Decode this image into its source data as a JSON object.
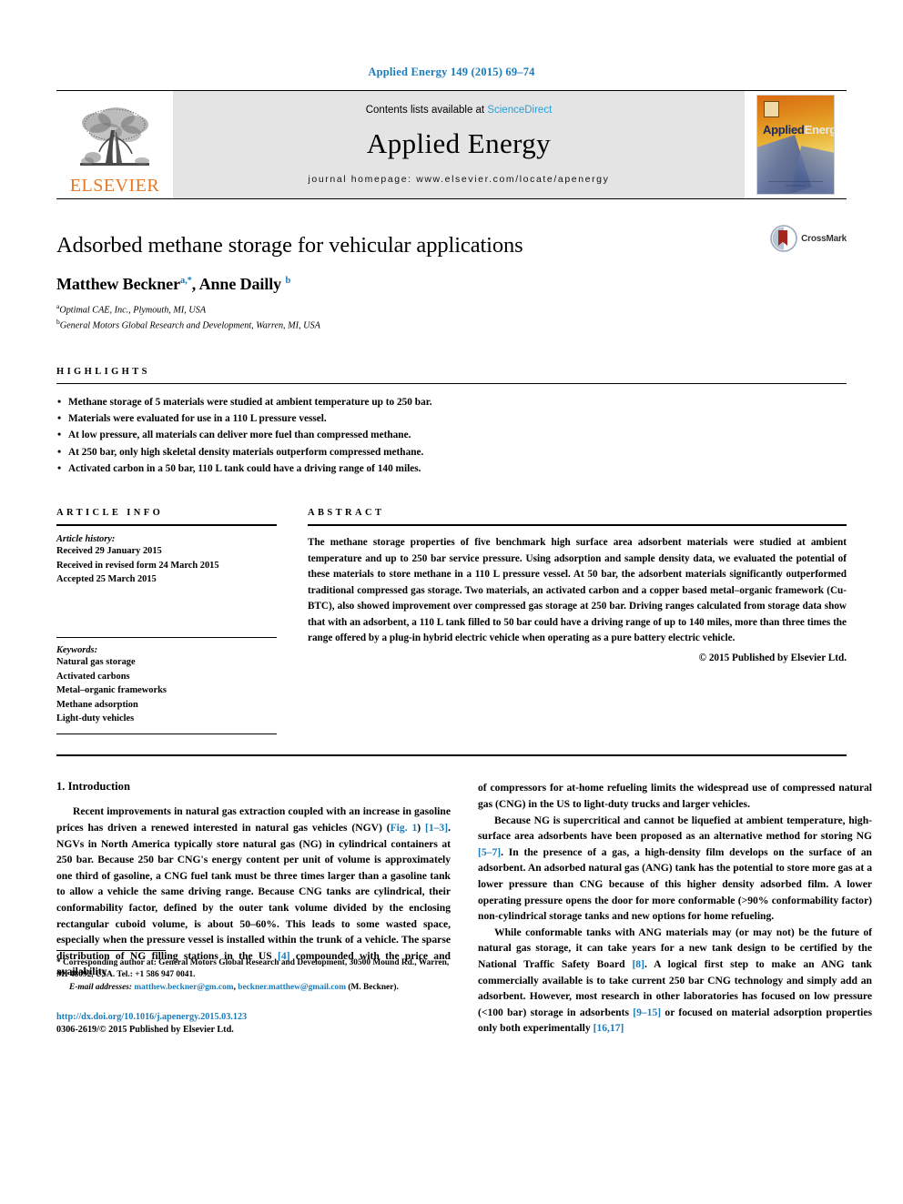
{
  "running_head": "Applied Energy 149 (2015) 69–74",
  "masthead": {
    "publisher_name": "ELSEVIER",
    "contents_prefix": "Contents lists available at ",
    "contents_link": "ScienceDirect",
    "journal_name": "Applied Energy",
    "homepage": "journal homepage: www.elsevier.com/locate/apenergy",
    "cover_title_applied": "Applied",
    "cover_title_energy": "Energy",
    "cover_footer": "ScienceDirect"
  },
  "article": {
    "title": "Adsorbed methane storage for vehicular applications",
    "authors_html": "Matthew Beckner, Anne Dailly",
    "author_1": "Matthew Beckner",
    "author_1_sup": "a,*",
    "author_2": "Anne Dailly",
    "author_2_sup": "b",
    "affiliation_a_sup": "a",
    "affiliation_a": "Optimal CAE, Inc., Plymouth, MI, USA",
    "affiliation_b_sup": "b",
    "affiliation_b": "General Motors Global Research and Development, Warren, MI, USA",
    "crossmark_label": "CrossMark"
  },
  "highlights": {
    "label": "HIGHLIGHTS",
    "items": [
      "Methane storage of 5 materials were studied at ambient temperature up to 250 bar.",
      "Materials were evaluated for use in a 110 L pressure vessel.",
      "At low pressure, all materials can deliver more fuel than compressed methane.",
      "At 250 bar, only high skeletal density materials outperform compressed methane.",
      "Activated carbon in a 50 bar, 110 L tank could have a driving range of 140 miles."
    ]
  },
  "article_info": {
    "label": "ARTICLE INFO",
    "history_head": "Article history:",
    "history": [
      "Received 29 January 2015",
      "Received in revised form 24 March 2015",
      "Accepted 25 March 2015"
    ],
    "keywords_head": "Keywords:",
    "keywords": [
      "Natural gas storage",
      "Activated carbons",
      "Metal–organic frameworks",
      "Methane adsorption",
      "Light-duty vehicles"
    ]
  },
  "abstract": {
    "label": "ABSTRACT",
    "body": "The methane storage properties of five benchmark high surface area adsorbent materials were studied at ambient temperature and up to 250 bar service pressure. Using adsorption and sample density data, we evaluated the potential of these materials to store methane in a 110 L pressure vessel. At 50 bar, the adsorbent materials significantly outperformed traditional compressed gas storage. Two materials, an activated carbon and a copper based metal–organic framework (Cu-BTC), also showed improvement over compressed gas storage at 250 bar. Driving ranges calculated from storage data show that with an adsorbent, a 110 L tank filled to 50 bar could have a driving range of up to 140 miles, more than three times the range offered by a plug-in hybrid electric vehicle when operating as a pure battery electric vehicle.",
    "copyright": "© 2015 Published by Elsevier Ltd."
  },
  "introduction": {
    "heading": "1. Introduction",
    "left_paragraph_1_a": "Recent improvements in natural gas extraction coupled with an increase in gasoline prices has driven a renewed interested in natural gas vehicles (NGV) (",
    "left_link_fig1": "Fig. 1",
    "left_paragraph_1_b": ") ",
    "left_link_1_3": "[1–3]",
    "left_paragraph_1_c": ". NGVs in North America typically store natural gas (NG) in cylindrical containers at 250 bar. Because 250 bar CNG's energy content per unit of volume is approximately one third of gasoline, a CNG fuel tank must be three times larger than a gasoline tank to allow a vehicle the same driving range. Because CNG tanks are cylindrical, their conformability factor, defined by the outer tank volume divided by the enclosing rectangular cuboid volume, is about 50–60%. This leads to some wasted space, especially when the pressure vessel is installed within the trunk of a vehicle. The sparse distribution of NG filling stations in the US ",
    "left_link_4": "[4]",
    "left_paragraph_1_d": " compounded with the price and availability",
    "right_paragraph_1": "of compressors for at-home refueling limits the widespread use of compressed natural gas (CNG) in the US to light-duty trucks and larger vehicles.",
    "right_paragraph_2_a": "Because NG is supercritical and cannot be liquefied at ambient temperature, high-surface area adsorbents have been proposed as an alternative method for storing NG ",
    "right_link_5_7": "[5–7]",
    "right_paragraph_2_b": ". In the presence of a gas, a high-density film develops on the surface of an adsorbent. An adsorbed natural gas (ANG) tank has the potential to store more gas at a lower pressure than CNG because of this higher density adsorbed film. A lower operating pressure opens the door for more conformable (>90% conformability factor) non-cylindrical storage tanks and new options for home refueling.",
    "right_paragraph_3_a": "While conformable tanks with ANG materials may (or may not) be the future of natural gas storage, it can take years for a new tank design to be certified by the National Traffic Safety Board ",
    "right_link_8": "[8]",
    "right_paragraph_3_b": ". A logical first step to make an ANG tank commercially available is to take current 250 bar CNG technology and simply add an adsorbent. However, most research in other laboratories has focused on low pressure (<100 bar) storage in adsorbents ",
    "right_link_9_15": "[9–15]",
    "right_paragraph_3_c": " or focused on material adsorption properties only both experimentally ",
    "right_link_16_17": "[16,17]"
  },
  "footnote": {
    "corresponding_marker": "*",
    "corresponding_text": "Corresponding author at: General Motors Global Research and Development, 30500 Mound Rd., Warren, MI 48092, USA. Tel.: +1 586 947 0041.",
    "email_label": "E-mail addresses:",
    "email_1": "matthew.beckner@gm.com",
    "email_separator": ", ",
    "email_2": "beckner.matthew@gmail.com",
    "email_author": "(M. Beckner).",
    "doi": "http://dx.doi.org/10.1016/j.apenergy.2015.03.123",
    "issn": "0306-2619/© 2015 Published by Elsevier Ltd."
  },
  "colors": {
    "link_blue": "#1a7bb9",
    "sciencedirect_blue": "#2a9fd6",
    "elsevier_orange": "#E87722",
    "masthead_gray": "#e4e4e4",
    "crossmark_red": "#a5261c"
  }
}
